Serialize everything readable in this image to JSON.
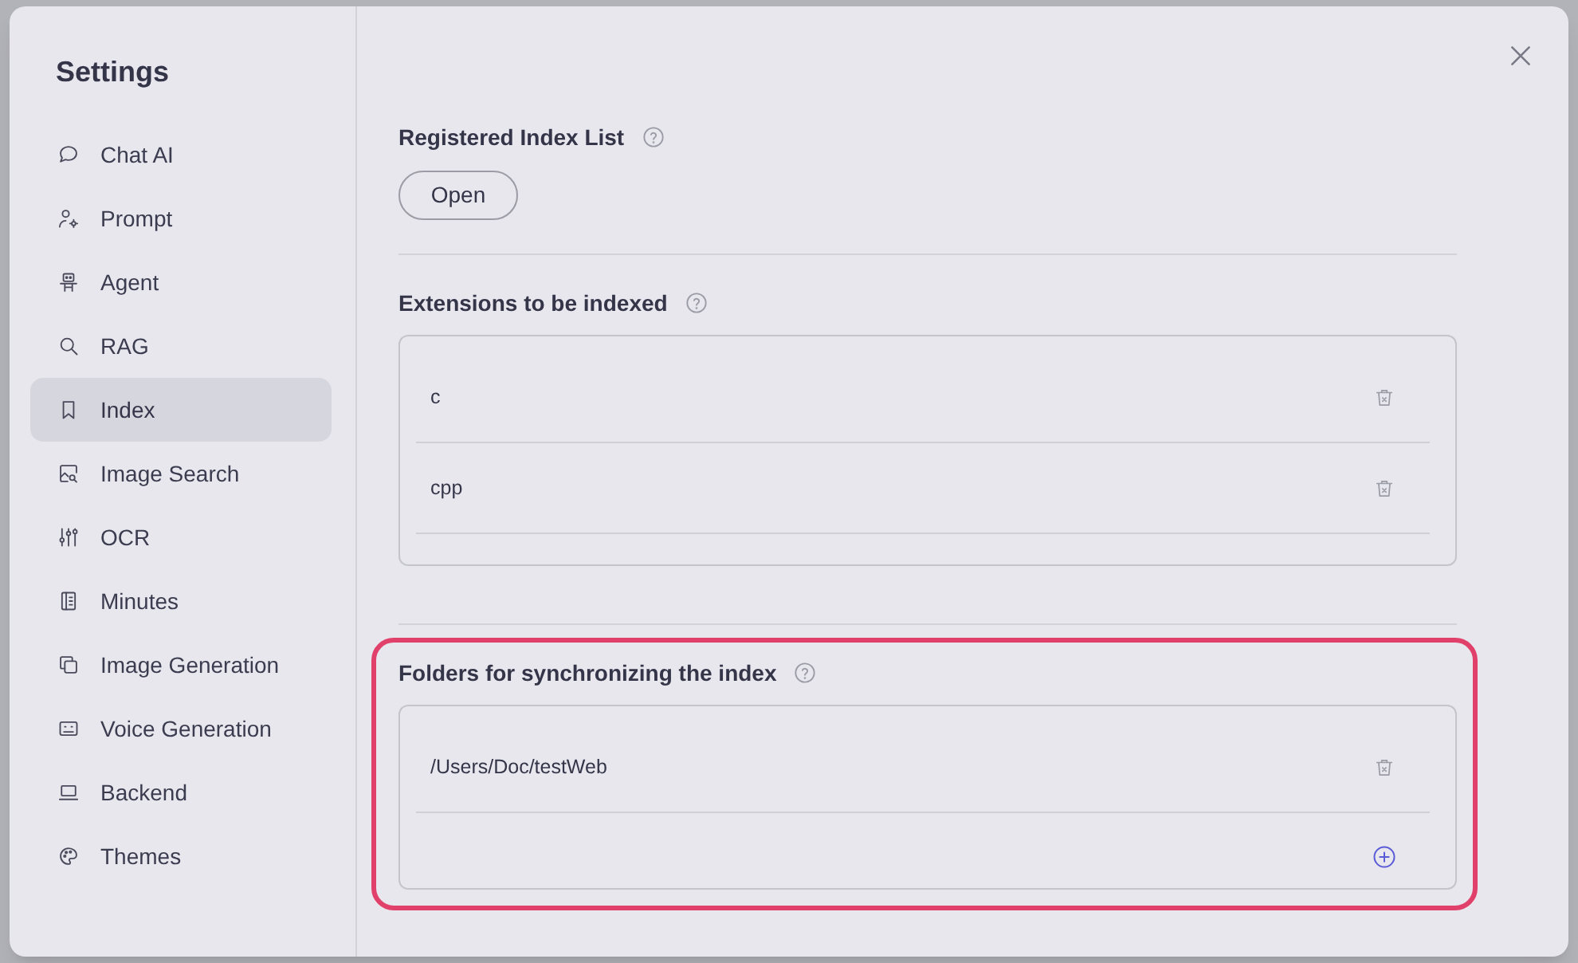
{
  "window": {
    "title": "Settings"
  },
  "sidebar": {
    "items": [
      {
        "label": "Chat AI",
        "selected": false
      },
      {
        "label": "Prompt",
        "selected": false
      },
      {
        "label": "Agent",
        "selected": false
      },
      {
        "label": "RAG",
        "selected": false
      },
      {
        "label": "Index",
        "selected": true
      },
      {
        "label": "Image Search",
        "selected": false
      },
      {
        "label": "OCR",
        "selected": false
      },
      {
        "label": "Minutes",
        "selected": false
      },
      {
        "label": "Image Generation",
        "selected": false
      },
      {
        "label": "Voice Generation",
        "selected": false
      },
      {
        "label": "Backend",
        "selected": false
      },
      {
        "label": "Themes",
        "selected": false
      }
    ]
  },
  "sections": [
    {
      "kind": "button",
      "title": "Registered Index List",
      "button": "Open",
      "highlighted": false
    },
    {
      "kind": "list",
      "title": "Extensions to be indexed",
      "items": [
        "c",
        "cpp"
      ],
      "add_button": false,
      "highlighted": false
    },
    {
      "kind": "list",
      "title": "Folders for synchronizing the index",
      "items": [
        "/Users/Doc/testWeb"
      ],
      "add_button": true,
      "highlighted": true
    }
  ]
}
